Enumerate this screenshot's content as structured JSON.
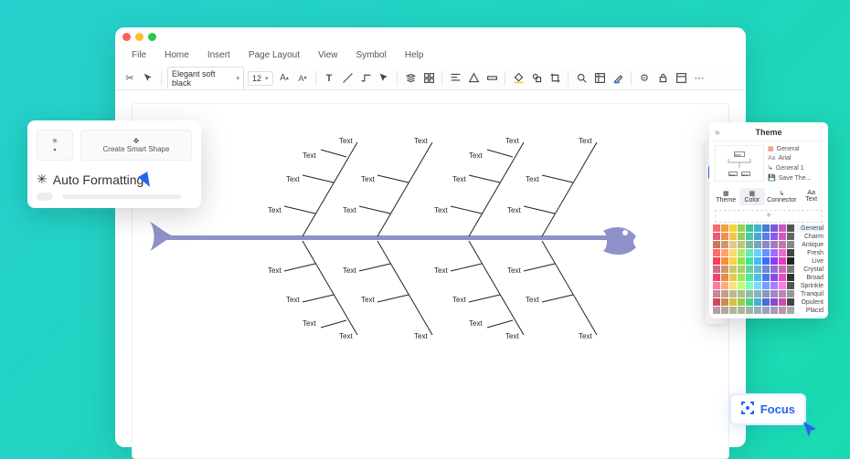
{
  "menus": [
    "File",
    "Home",
    "Insert",
    "Page Layout",
    "View",
    "Symbol",
    "Help"
  ],
  "toolbar": {
    "font_family": "Elegant soft black",
    "font_size": "12"
  },
  "popup": {
    "create_smart_shape": "Create Smart Shape",
    "auto_formatting": "Auto Formatting"
  },
  "diagram": {
    "label": "Text"
  },
  "theme_panel": {
    "title": "Theme",
    "meta": {
      "general": "General",
      "font": "Arial",
      "set": "General 1",
      "save": "Save The..."
    },
    "tabs": [
      "Theme",
      "Color",
      "Connector",
      "Text"
    ],
    "active_tab": 1,
    "palettes": [
      {
        "name": "General",
        "colors": [
          "#f26d6d",
          "#f2a23a",
          "#f2d43a",
          "#9ed04a",
          "#3ac98f",
          "#3ab7d0",
          "#4a7bd0",
          "#7a5bd0",
          "#c95bc0",
          "#555"
        ],
        "selected": true
      },
      {
        "name": "Charm",
        "colors": [
          "#e85a7a",
          "#f08c5a",
          "#f2c54a",
          "#8fd05a",
          "#4ac9a8",
          "#4aa8d0",
          "#5a7be8",
          "#8c5ae8",
          "#d05ac0",
          "#666"
        ]
      },
      {
        "name": "Antique",
        "colors": [
          "#c97a5a",
          "#d09a6a",
          "#e0c88a",
          "#b8c97a",
          "#7ab8a0",
          "#7aa0c0",
          "#8a8ac9",
          "#a07ac0",
          "#c07aa8",
          "#888"
        ]
      },
      {
        "name": "Fresh",
        "colors": [
          "#ff6b6b",
          "#ffa06b",
          "#ffd96b",
          "#b0e86b",
          "#6be8b0",
          "#6bd0ff",
          "#6b8fff",
          "#a06bff",
          "#e86bd0",
          "#444"
        ]
      },
      {
        "name": "Live",
        "colors": [
          "#ff3b5a",
          "#ff8a3b",
          "#ffd03b",
          "#8fe83b",
          "#3be89a",
          "#3bc0ff",
          "#3b6bff",
          "#8a3bff",
          "#e83bc0",
          "#222"
        ]
      },
      {
        "name": "Crystal",
        "colors": [
          "#d06b8a",
          "#d0986b",
          "#d0c86b",
          "#a8d06b",
          "#6bd0a0",
          "#6bb8d0",
          "#6b8ad0",
          "#986bd0",
          "#c86bb8",
          "#777"
        ]
      },
      {
        "name": "Broad",
        "colors": [
          "#e84a6b",
          "#e88a4a",
          "#e8c84a",
          "#a0e84a",
          "#4ae8a0",
          "#4ac0e8",
          "#4a7be8",
          "#8a4ae8",
          "#e84ac0",
          "#333"
        ]
      },
      {
        "name": "Sprinkle",
        "colors": [
          "#ff7a9a",
          "#ffaa7a",
          "#ffe07a",
          "#b8ff7a",
          "#7affb8",
          "#7ad8ff",
          "#7a9aff",
          "#aa7aff",
          "#ff7ae0",
          "#555"
        ]
      },
      {
        "name": "Tranquil",
        "colors": [
          "#c08a9a",
          "#c0a08a",
          "#c0b88a",
          "#a8c08a",
          "#8ac0a0",
          "#8ab0c0",
          "#8a98c0",
          "#a08ac0",
          "#b88ab0",
          "#999"
        ]
      },
      {
        "name": "Opulent",
        "colors": [
          "#d04a5a",
          "#d0884a",
          "#d0c04a",
          "#98d04a",
          "#4ad088",
          "#4ab0d0",
          "#4a6bd0",
          "#884ad0",
          "#d04ab0",
          "#444"
        ]
      },
      {
        "name": "Placid",
        "colors": [
          "#b89aa8",
          "#b8a89a",
          "#b8b49a",
          "#acb89a",
          "#9ab8a8",
          "#9ab0b8",
          "#9aa4b8",
          "#a89ab8",
          "#b49aac",
          "#aaa"
        ]
      }
    ]
  },
  "focus_button": "Focus",
  "strip_icons": [
    "menu-icon",
    "grid-icon",
    "layers-icon",
    "shapes-icon",
    "page-icon",
    "text-icon",
    "expand-icon",
    "cart-icon",
    "cloud-icon"
  ]
}
